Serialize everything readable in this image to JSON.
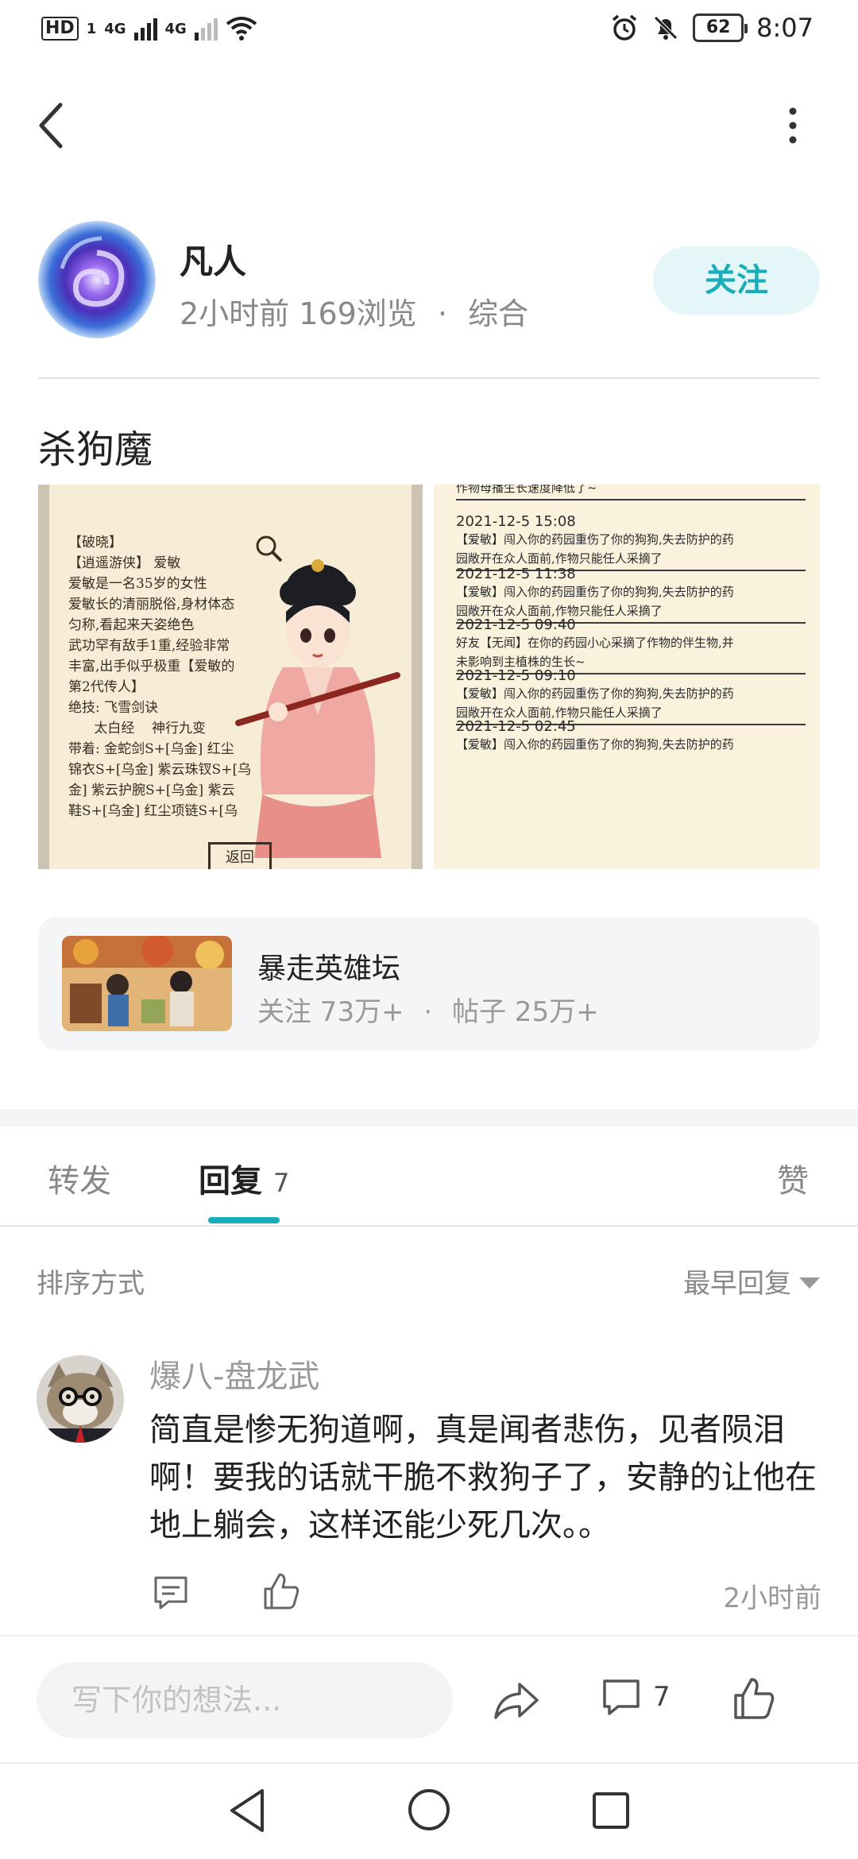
{
  "status_bar": {
    "hd": "HD",
    "sim1": "1",
    "network1": "4G",
    "network2": "4G",
    "battery": "62",
    "time": "8:07"
  },
  "author": {
    "name": "凡人",
    "time": "2小时前",
    "views": "169浏览",
    "separator": "·",
    "category": "综合",
    "follow_label": "关注"
  },
  "post": {
    "title": "杀狗魔",
    "image1": {
      "lines": "【破晓】\n【逍遥游侠】 爱敏\n爱敏是一名35岁的女性\n爱敏长的清丽脱俗,身材体态\n匀称,看起来天姿绝色\n武功罕有敌手1重,经验非常\n丰富,出手似乎极重【爱敏的\n第2代传人】\n绝技: 飞雪剑诀\n      太白经    神行九变\n带着: 金蛇剑S+[乌金] 红尘\n锦衣S+[乌金] 紫云珠钗S+[乌\n金] 紫云护腕S+[乌金] 紫云\n鞋S+[乌金] 红尘项链S+[乌",
      "return_label": "返回"
    },
    "image2": {
      "entries": [
        {
          "date": "",
          "text": "作物母播生长速度降低了~"
        },
        {
          "date": "2021-12-5 15:08",
          "text": "【爱敏】闯入你的药园重伤了你的狗狗,失去防护的药\n园敞开在众人面前,作物只能任人采摘了"
        },
        {
          "date": "2021-12-5 11:38",
          "text": "【爱敏】闯入你的药园重伤了你的狗狗,失去防护的药\n园敞开在众人面前,作物只能任人采摘了"
        },
        {
          "date": "2021-12-5 09:40",
          "text": "好友【无闻】在你的药园小心采摘了作物的伴生物,并\n未影响到主植株的生长~"
        },
        {
          "date": "2021-12-5 09:10",
          "text": "【爱敏】闯入你的药园重伤了你的狗狗,失去防护的药\n园敞开在众人面前,作物只能任人采摘了"
        },
        {
          "date": "2021-12-5 02:45",
          "text": "【爱敏】闯入你的药园重伤了你的狗狗,失去防护的药"
        }
      ]
    }
  },
  "forum": {
    "name": "暴走英雄坛",
    "followers": "关注 73万+",
    "separator": "·",
    "posts": "帖子 25万+"
  },
  "tabs": {
    "repost": "转发",
    "reply": "回复",
    "reply_count": "7",
    "like": "赞"
  },
  "sort": {
    "label": "排序方式",
    "value": "最早回复"
  },
  "comment": {
    "user": "爆八-盘龙武",
    "text": "简直是惨无狗道啊，真是闻者悲伤，见者陨泪啊！要我的话就干脆不救狗子了，安静的让他在地上躺会，这样还能少死几次。。",
    "time": "2小时前"
  },
  "bottom_bar": {
    "input_placeholder": "写下你的想法...",
    "comment_count": "7"
  },
  "colors": {
    "accent": "#18adb8",
    "follow_bg": "#e4f6f7",
    "muted_text": "#888888",
    "card_bg": "#f4f5f7"
  }
}
